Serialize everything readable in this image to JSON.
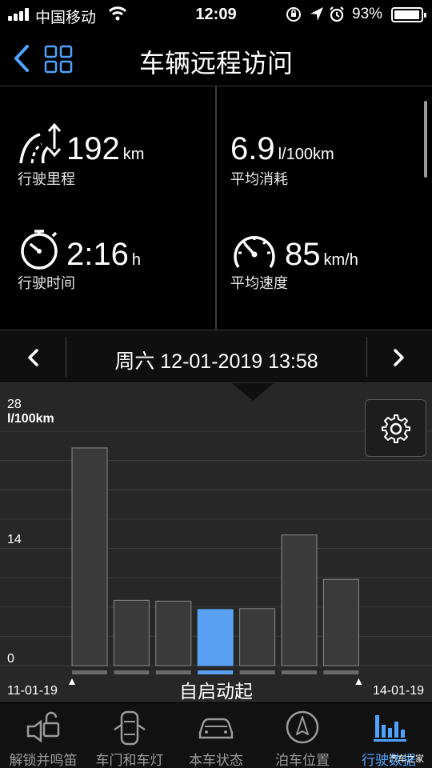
{
  "status_bar": {
    "carrier": "中国移动",
    "time": "12:09",
    "battery": "93%",
    "battery_level": 0.93
  },
  "nav": {
    "title": "车辆远程访问"
  },
  "stats": [
    {
      "value": "192",
      "unit": "km",
      "label": "行驶里程",
      "icon": "road-distance-icon"
    },
    {
      "value": "6.9",
      "unit": "l/100km",
      "label": "平均消耗",
      "icon": ""
    },
    {
      "value": "2:16",
      "unit": "h",
      "label": "行驶时间",
      "icon": "stopwatch-icon"
    },
    {
      "value": "85",
      "unit": "km/h",
      "label": "平均速度",
      "icon": "speedometer-icon"
    }
  ],
  "date_bar": {
    "text": "周六 12-01-2019 13:58"
  },
  "chart_data": {
    "type": "bar",
    "categories": [
      "11-01-19",
      "",
      "",
      "",
      "",
      "",
      "14-01-19"
    ],
    "values": [
      26,
      7.8,
      7.7,
      6.7,
      6.8,
      15.6,
      10.3
    ],
    "selected_index": 3,
    "ylim": [
      0,
      28
    ],
    "yticks": [
      0,
      14,
      28
    ],
    "ylabel": "l/100km",
    "y_top_label": "28",
    "y_mid_label": "14",
    "y_zero_label": "0",
    "x_start_label": "11-01-19",
    "x_end_label": "14-01-19",
    "mode_label": "自启动起",
    "colors": {
      "bar": "#3a3a3a",
      "bar_border": "#8a8a8a",
      "selected": "#5aa0f2"
    },
    "grid": true
  },
  "tabs": [
    {
      "label": "解锁并鸣笛",
      "icon": "lock-horn-icon",
      "active": false
    },
    {
      "label": "车门和车灯",
      "icon": "car-doors-icon",
      "active": false
    },
    {
      "label": "本车状态",
      "icon": "car-status-icon",
      "active": false
    },
    {
      "label": "泊车位置",
      "icon": "compass-icon",
      "active": false
    },
    {
      "label": "行驶数据",
      "icon": "bar-chart-icon",
      "active": true
    }
  ],
  "watermark": "汽车之家",
  "colors": {
    "accent": "#4fa3ff",
    "background": "#000000",
    "chart_bg": "#272727"
  }
}
